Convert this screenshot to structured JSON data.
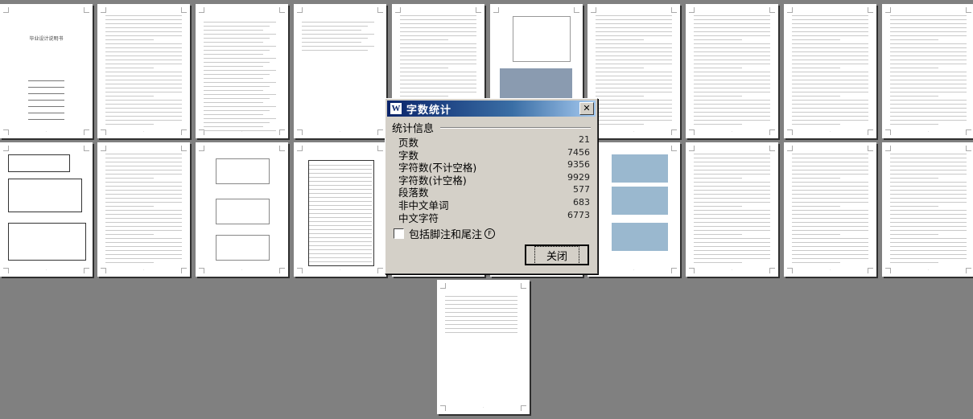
{
  "dialog": {
    "title": "字数统计",
    "icon_letter": "W",
    "close_glyph": "✕",
    "group_label": "统计信息",
    "stats": [
      {
        "label": "页数",
        "value": "21"
      },
      {
        "label": "字数",
        "value": "7456"
      },
      {
        "label": "字符数(不计空格)",
        "value": "9356"
      },
      {
        "label": "字符数(计空格)",
        "value": "9929"
      },
      {
        "label": "段落数",
        "value": "577"
      },
      {
        "label": "非中文单词",
        "value": "683"
      },
      {
        "label": "中文字符",
        "value": "6773"
      }
    ],
    "checkbox_label": "包括脚注和尾注",
    "checkbox_hotkey": "F",
    "checkbox_checked": false,
    "close_button": "关闭"
  },
  "document": {
    "cover_title": "毕业设计说明书",
    "page_count_shown": 21,
    "thumbnails": [
      {
        "kind": "cover"
      },
      {
        "kind": "text"
      },
      {
        "kind": "toc"
      },
      {
        "kind": "toc2"
      },
      {
        "kind": "text"
      },
      {
        "kind": "figure"
      },
      {
        "kind": "text"
      },
      {
        "kind": "text"
      },
      {
        "kind": "table-text"
      },
      {
        "kind": "text"
      },
      {
        "kind": "tables"
      },
      {
        "kind": "text"
      },
      {
        "kind": "drawings"
      },
      {
        "kind": "bigtable"
      },
      {
        "kind": "text"
      },
      {
        "kind": "screens"
      },
      {
        "kind": "photos"
      },
      {
        "kind": "text"
      },
      {
        "kind": "text"
      },
      {
        "kind": "text"
      },
      {
        "kind": "refs"
      }
    ]
  }
}
